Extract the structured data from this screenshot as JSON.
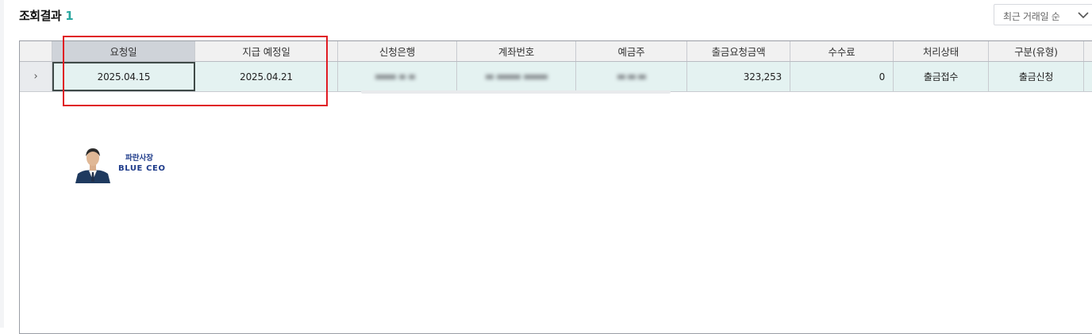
{
  "header": {
    "title": "조회결과",
    "count": "1"
  },
  "sort_select": {
    "value": "최근 거래일 순",
    "icon": "chevron-down-icon"
  },
  "table": {
    "columns": [
      "요청일",
      "지급 예정일",
      "신청은행",
      "계좌번호",
      "예금주",
      "출금요청금액",
      "수수료",
      "처리상태",
      "구분(유형)"
    ],
    "rows": [
      {
        "handle": "›",
        "request_date": "2025.04.15",
        "scheduled_date": "2025.04.21",
        "amount": "323,253",
        "fee": "0",
        "status": "출금접수",
        "type": "출금신청"
      }
    ]
  },
  "watermark": {
    "line1": "파란사장",
    "line2": "BLUE CEO"
  },
  "colors": {
    "accent": "#2aa7a0",
    "highlight": "#e01b23",
    "row_bg": "#e4f2f1",
    "logo_text": "#1e3b8a"
  }
}
